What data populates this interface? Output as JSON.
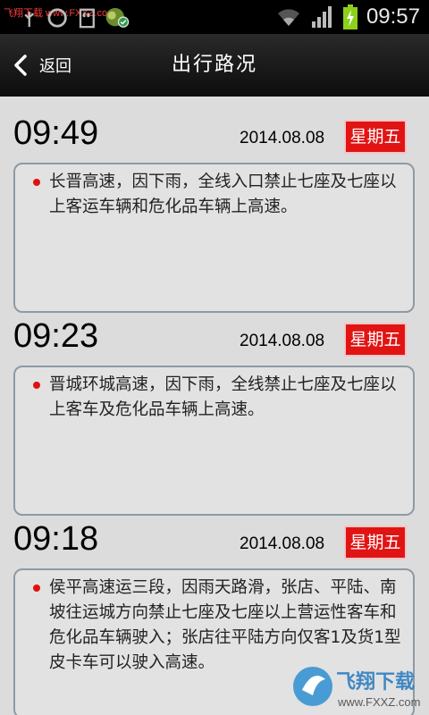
{
  "status_bar": {
    "watermark_text": "飞翔下载 www.FXXZ.com",
    "time": "09:57",
    "icons": [
      "usb-icon",
      "sync-icon",
      "sd-card-icon",
      "app-notification-icon",
      "wifi-icon",
      "signal-icon",
      "battery-charging-icon"
    ]
  },
  "header": {
    "back_label": "返回",
    "title": "出行路况"
  },
  "entries": [
    {
      "time": "09:49",
      "date": "2014.08.08",
      "weekday": "星期五",
      "text": "长晋高速，因下雨，全线入口禁止七座及七座以上客运车辆和危化品车辆上高速。"
    },
    {
      "time": "09:23",
      "date": "2014.08.08",
      "weekday": "星期五",
      "text": "晋城环城高速，因下雨，全线禁止七座及七座以上客车及危化品车辆上高速。"
    },
    {
      "time": "09:18",
      "date": "2014.08.08",
      "weekday": "星期五",
      "text": "侯平高速运三段，因雨天路滑，张店、平陆、南坡往运城方向禁止七座及七座以上营运性客车和危化品车辆驶入；张店往平陆方向仅客1及货1型皮卡车可以驶入高速。"
    }
  ],
  "watermark": {
    "name": "飞翔下载",
    "url": "www.FXXZ.com"
  },
  "colors": {
    "badge": "#e11414",
    "dot": "#e31010",
    "background": "#dcdcdc",
    "card_border": "#8e9aa3"
  }
}
